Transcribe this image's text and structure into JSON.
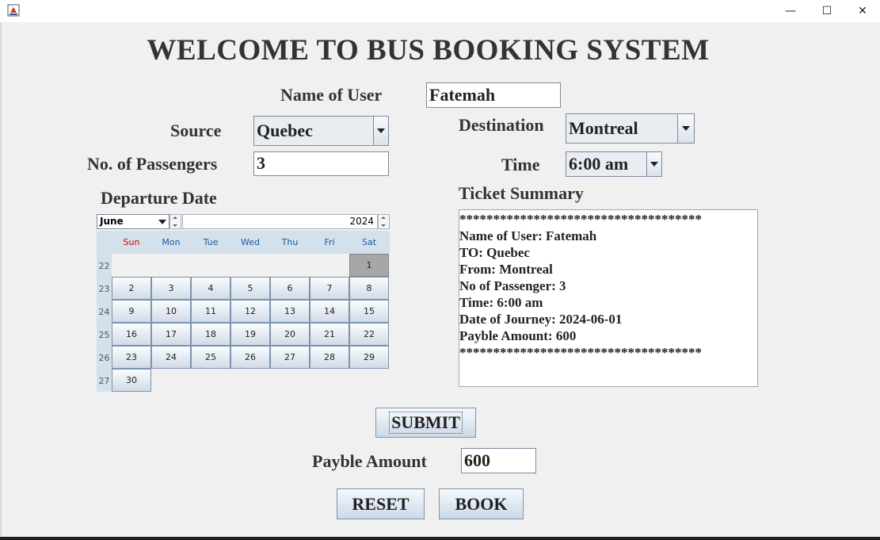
{
  "window": {
    "minimize_glyph": "—",
    "maximize_glyph": "☐",
    "close_glyph": "✕"
  },
  "heading": "WELCOME TO BUS BOOKING SYSTEM",
  "form": {
    "name_label": "Name of User",
    "name_value": "Fatemah",
    "source_label": "Source",
    "source_value": "Quebec",
    "destination_label": "Destination",
    "destination_value": "Montreal",
    "passengers_label": "No. of Passengers",
    "passengers_value": "3",
    "time_label": "Time",
    "time_value": "6:00 am",
    "departure_label": "Departure Date"
  },
  "calendar": {
    "month": "June",
    "year": "2024",
    "day_names": [
      "Sun",
      "Mon",
      "Tue",
      "Wed",
      "Thu",
      "Fri",
      "Sat"
    ],
    "week_numbers": [
      "22",
      "23",
      "24",
      "25",
      "26",
      "27"
    ],
    "selected_day": "1",
    "days": [
      "1",
      "2",
      "3",
      "4",
      "5",
      "6",
      "7",
      "8",
      "9",
      "10",
      "11",
      "12",
      "13",
      "14",
      "15",
      "16",
      "17",
      "18",
      "19",
      "20",
      "21",
      "22",
      "23",
      "24",
      "25",
      "26",
      "27",
      "28",
      "29",
      "30"
    ],
    "first_weekday_index": 6
  },
  "summary": {
    "title": "Ticket Summary",
    "lines": [
      "************************************",
      "Name of User: Fatemah",
      "TO: Quebec",
      "From: Montreal",
      "No of Passenger: 3",
      "Time: 6:00 am",
      "Date of Journey: 2024-06-01",
      "Payble Amount: 600",
      "************************************"
    ]
  },
  "submit_label": "SUBMIT",
  "amount": {
    "label": "Payble Amount",
    "value": "600"
  },
  "reset_label": "RESET",
  "book_label": "BOOK",
  "colors": {
    "background": "#f0f0f0",
    "sunday": "#cc0000",
    "weekday": "#1e5aa0",
    "header_band": "#d3e1ec",
    "selected_day": "#a6a6a6"
  }
}
